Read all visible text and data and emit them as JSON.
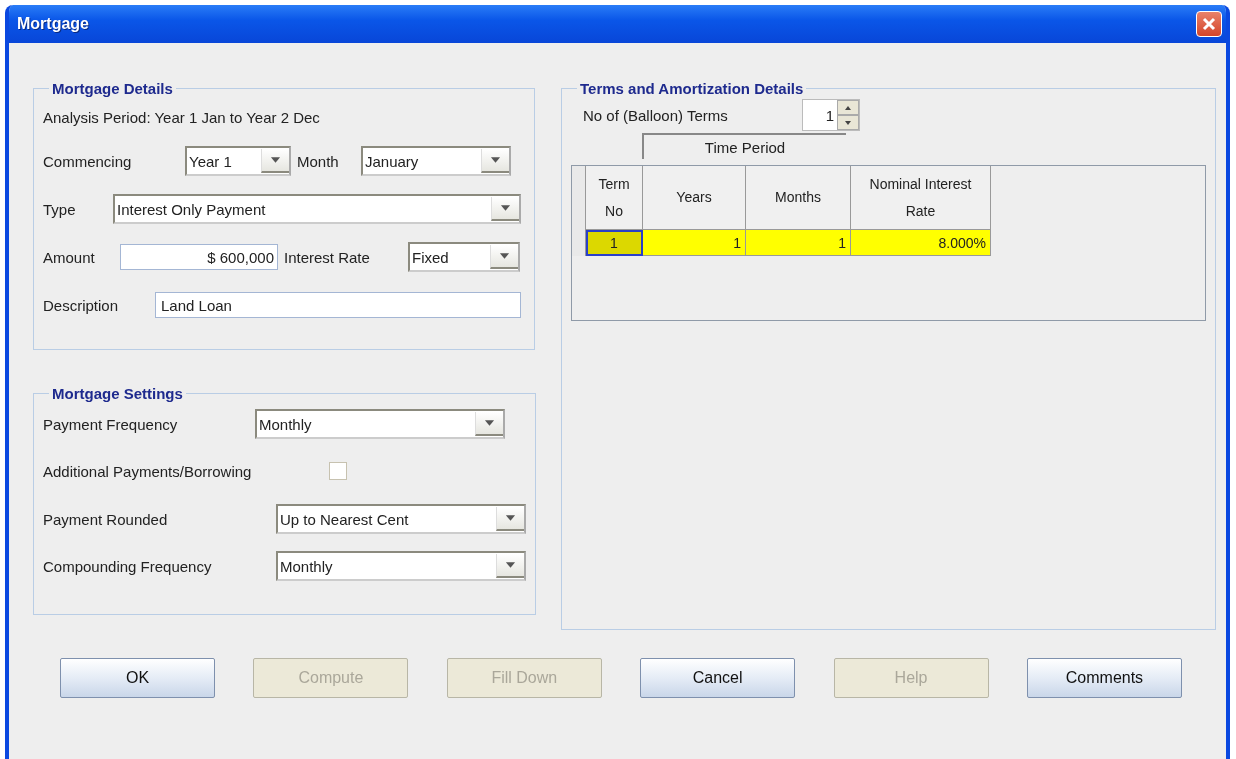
{
  "window": {
    "title": "Mortgage"
  },
  "mortgage_details": {
    "title": "Mortgage Details",
    "analysis_period": "Analysis Period: Year 1 Jan to Year 2 Dec",
    "commencing": {
      "label": "Commencing",
      "value": "Year 1"
    },
    "month": {
      "label": "Month",
      "value": "January"
    },
    "type": {
      "label": "Type",
      "value": "Interest Only Payment"
    },
    "amount": {
      "label": "Amount",
      "value": "$ 600,000"
    },
    "interest_rate": {
      "label": "Interest Rate",
      "value": "Fixed"
    },
    "description": {
      "label": "Description",
      "value": "Land Loan"
    }
  },
  "mortgage_settings": {
    "title": "Mortgage Settings",
    "payment_frequency": {
      "label": "Payment Frequency",
      "value": "Monthly"
    },
    "additional_payments": {
      "label": "Additional Payments/Borrowing",
      "checked": false
    },
    "payment_rounded": {
      "label": "Payment Rounded",
      "value": "Up to Nearest Cent"
    },
    "compounding_frequency": {
      "label": "Compounding Frequency",
      "value": "Monthly"
    }
  },
  "terms": {
    "title": "Terms and Amortization Details",
    "balloon_terms": {
      "label": "No of (Balloon) Terms",
      "value": "1"
    },
    "group_header": "Time Period",
    "columns": [
      "Term No",
      "Years",
      "Months",
      "Nominal Interest Rate"
    ],
    "rows": [
      {
        "cells": [
          "1",
          "1",
          "1",
          "8.000%"
        ]
      }
    ]
  },
  "buttons": [
    {
      "label": "OK",
      "disabled": false
    },
    {
      "label": "Compute",
      "disabled": true
    },
    {
      "label": "Fill Down",
      "disabled": true
    },
    {
      "label": "Cancel",
      "disabled": false
    },
    {
      "label": "Help",
      "disabled": true
    },
    {
      "label": "Comments",
      "disabled": false
    }
  ]
}
